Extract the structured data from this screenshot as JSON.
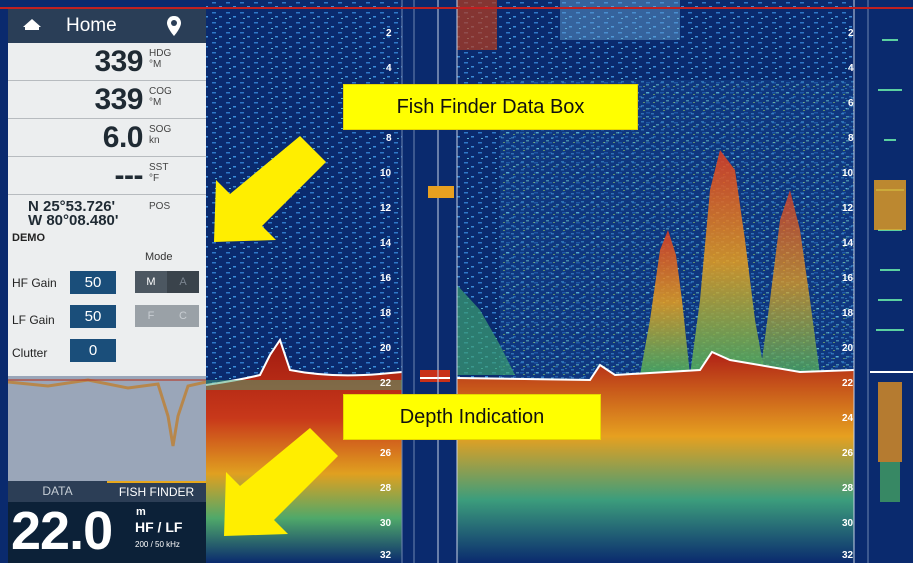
{
  "colors": {
    "water": "#0a2a6e",
    "panel": "#eceeef",
    "bar": "#2a3e57",
    "accent": "#e8a81b",
    "callout": "#ffff00",
    "arrow": "#ffee00"
  },
  "header": {
    "title": "Home",
    "home_icon": "home-icon",
    "location_icon": "location-pin-icon"
  },
  "data_box": {
    "hdg": {
      "value": "339",
      "unit_top": "HDG",
      "unit_bottom": "°M"
    },
    "cog": {
      "value": "339",
      "unit_top": "COG",
      "unit_bottom": "°M"
    },
    "sog": {
      "value": "6.0",
      "unit_top": "SOG",
      "unit_bottom": "kn"
    },
    "sst": {
      "value": "---",
      "unit_top": "SST",
      "unit_bottom": "°F"
    },
    "pos": {
      "lat": "N 25°53.726'",
      "lon": "W 80°08.480'",
      "label": "POS"
    }
  },
  "gain_box": {
    "demo": "DEMO",
    "mode_label": "Mode",
    "hf_gain": {
      "label": "HF Gain",
      "value": "50"
    },
    "lf_gain": {
      "label": "LF Gain",
      "value": "50"
    },
    "clutter": {
      "label": "Clutter",
      "value": "0"
    },
    "mode_seg_1": {
      "a": "M",
      "b": "A"
    },
    "mode_seg_2": {
      "a": "F",
      "b": "C"
    }
  },
  "tabs": [
    {
      "label": "DATA"
    },
    {
      "label": "FISH FINDER"
    }
  ],
  "depth": {
    "value": "22.0",
    "unit": "m",
    "freq": "HF / LF",
    "khz": "200 / 50 kHz"
  },
  "callouts": {
    "data_box": "Fish Finder Data Box",
    "depth": "Depth Indication"
  },
  "depth_scale": [
    "2",
    "4",
    "6",
    "8",
    "10",
    "12",
    "14",
    "16",
    "18",
    "20",
    "22",
    "24",
    "26",
    "28",
    "30",
    "32"
  ]
}
